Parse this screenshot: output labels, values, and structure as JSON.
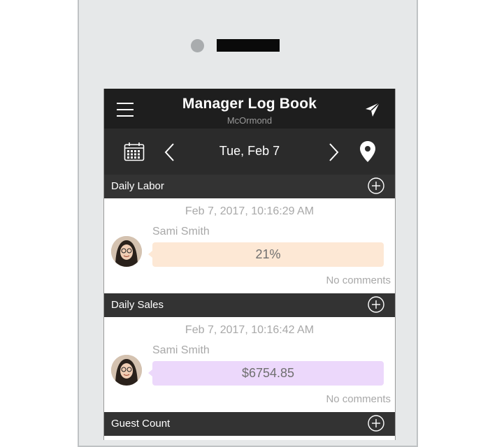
{
  "app": {
    "title": "Manager Log Book",
    "subtitle": "McOrmond",
    "date": "Tue, Feb 7"
  },
  "icons": {
    "menu": "hamburger-menu-icon",
    "send": "paper-plane-icon",
    "calendar": "calendar-icon",
    "prev": "chevron-left-icon",
    "next": "chevron-right-icon",
    "location": "map-pin-icon",
    "add": "plus-circle-icon"
  },
  "colors": {
    "labor_bubble": "#fde8d5",
    "sales_bubble": "#ecd8fb",
    "header": "#1e1e1e",
    "section": "#333333"
  },
  "sections": [
    {
      "label": "Daily Labor",
      "entry": {
        "time": "Feb 7, 2017, 10:16:29 AM",
        "author": "Sami Smith",
        "value": "21%",
        "comments": "No comments"
      }
    },
    {
      "label": "Daily Sales",
      "entry": {
        "time": "Feb 7, 2017, 10:16:42 AM",
        "author": "Sami Smith",
        "value": "$6754.85",
        "comments": "No comments"
      }
    },
    {
      "label": "Guest Count"
    }
  ]
}
